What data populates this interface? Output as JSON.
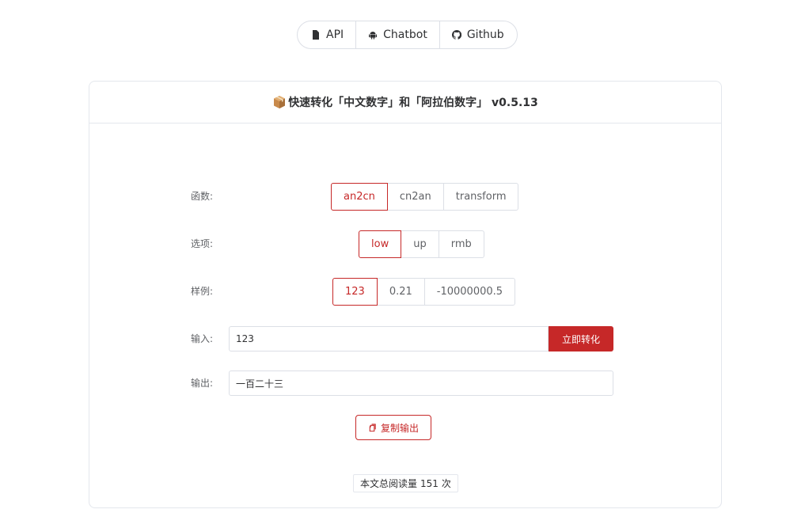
{
  "nav": {
    "items": [
      {
        "label": "API",
        "icon": "file-icon"
      },
      {
        "label": "Chatbot",
        "icon": "android-icon"
      },
      {
        "label": "Github",
        "icon": "github-icon"
      }
    ]
  },
  "card": {
    "title": "快速转化「中文数字」和「阿拉伯数字」 v0.5.13"
  },
  "form": {
    "function_label": "函数:",
    "functions": [
      "an2cn",
      "cn2an",
      "transform"
    ],
    "function_selected": "an2cn",
    "option_label": "选项:",
    "options": [
      "low",
      "up",
      "rmb"
    ],
    "option_selected": "low",
    "example_label": "样例:",
    "examples": [
      "123",
      "0.21",
      "-10000000.5"
    ],
    "example_selected": "123",
    "input_label": "输入:",
    "input_value": "123",
    "convert_button": "立即转化",
    "output_label": "输出:",
    "output_value": "一百二十三",
    "copy_button": "复制输出"
  },
  "footer": {
    "counter_prefix": "本文总阅读量",
    "counter_value": "151",
    "counter_suffix": "次"
  },
  "colors": {
    "accent": "#c62828",
    "border": "#dcdfe6"
  }
}
